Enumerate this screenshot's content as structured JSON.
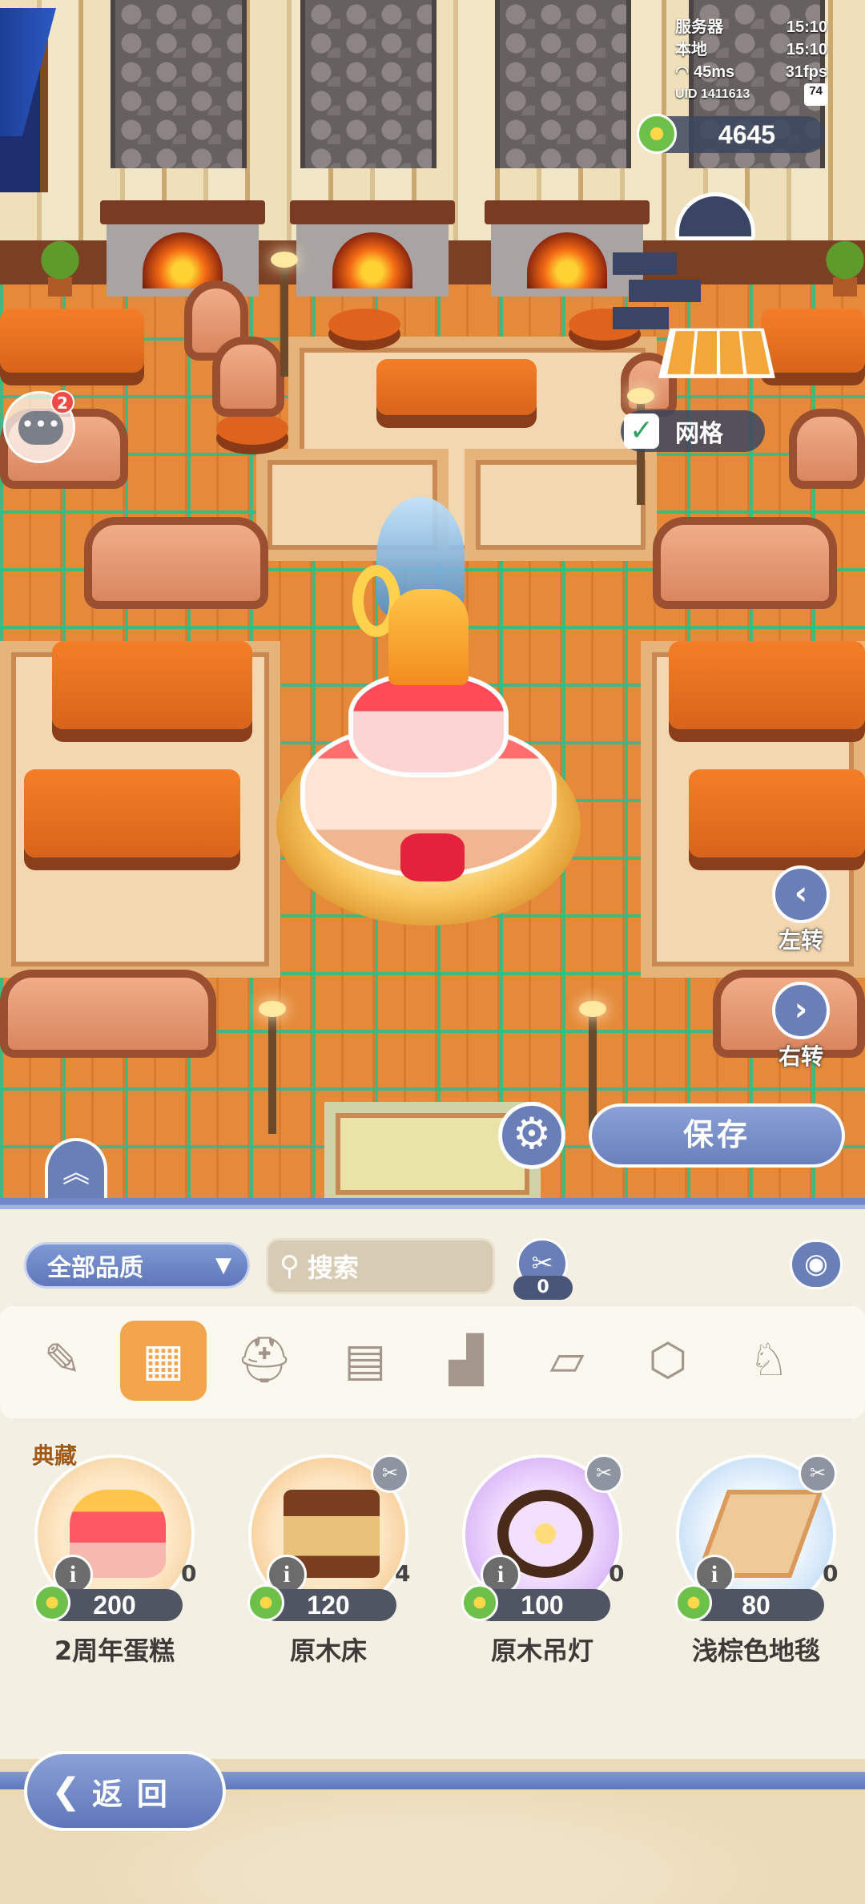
{
  "status": {
    "server_label": "服务器",
    "server_time": "15:10",
    "local_label": "本地",
    "local_time": "15:10",
    "ping": "45ms",
    "fps": "31fps",
    "uid": "UID 1411613",
    "battery": "74"
  },
  "currency": {
    "amount": "4645"
  },
  "grid_toggle": {
    "label": "网格",
    "checked": true
  },
  "chat": {
    "badge": "2"
  },
  "rotate_left": {
    "label": "左转"
  },
  "rotate_right": {
    "label": "右转"
  },
  "save_button": {
    "label": "保存"
  },
  "panel": {
    "quality_filter": "全部品质",
    "search_placeholder": "搜索",
    "tool_count": "0",
    "categories": [
      {
        "icon": "pencil-ruler-icon",
        "active": false
      },
      {
        "icon": "grid-list-icon",
        "active": true
      },
      {
        "icon": "helmet-icon",
        "active": false
      },
      {
        "icon": "brick-wall-icon",
        "active": false
      },
      {
        "icon": "building-icon",
        "active": false
      },
      {
        "icon": "floor-tile-icon",
        "active": false
      },
      {
        "icon": "box-icon",
        "active": false
      },
      {
        "icon": "duck-icon",
        "active": false
      }
    ],
    "items": [
      {
        "name": "2周年蛋糕",
        "price": "200",
        "qty": "0",
        "tag": "典藏"
      },
      {
        "name": "原木床",
        "price": "120",
        "qty": "4",
        "tag": ""
      },
      {
        "name": "原木吊灯",
        "price": "100",
        "qty": "0",
        "tag": ""
      },
      {
        "name": "浅棕色地毯",
        "price": "80",
        "qty": "0",
        "tag": ""
      }
    ],
    "back_label": "返回"
  },
  "colors": {
    "accent_blue": "#6a7fb8",
    "active_category": "#f2a54d",
    "grid_line": "#28be8c"
  }
}
